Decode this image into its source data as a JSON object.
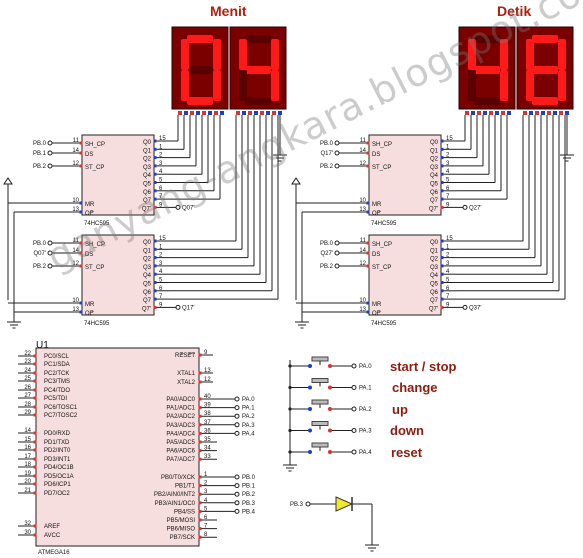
{
  "titles": {
    "minutes": "Menit",
    "seconds": "Detik"
  },
  "displays": {
    "minutes": [
      "0",
      "4"
    ],
    "seconds": [
      "4",
      "8"
    ]
  },
  "colors": {
    "segment_on": "#ff1a1a",
    "display_bg": "#7a0000",
    "chip_fill": "#f7dede",
    "pin_red": "#d83232",
    "pin_blue": "#1c3fc4",
    "wire": "#202020",
    "label_red": "#8c1c10"
  },
  "shift_register": {
    "part": "74HC595",
    "left_pins": [
      {
        "name": "SH_CP",
        "num": "11"
      },
      {
        "name": "DS",
        "num": "14"
      },
      {
        "name": "ST_CP",
        "num": "12"
      },
      {
        "name": "MR",
        "num": "10"
      },
      {
        "name": "OE",
        "num": "13"
      }
    ],
    "right_pins": [
      {
        "name": "Q0",
        "num": "15"
      },
      {
        "name": "Q1",
        "num": "1"
      },
      {
        "name": "Q2",
        "num": "2"
      },
      {
        "name": "Q3",
        "num": "3"
      },
      {
        "name": "Q4",
        "num": "4"
      },
      {
        "name": "Q5",
        "num": "5"
      },
      {
        "name": "Q6",
        "num": "6"
      },
      {
        "name": "Q7",
        "num": "7"
      },
      {
        "name": "Q7'",
        "num": "9"
      }
    ]
  },
  "shift_registers": [
    {
      "nets": [
        "PB.0",
        "PB.1",
        "PB.2"
      ],
      "out": "Q07'"
    },
    {
      "nets": [
        "PB.0",
        "Q07'",
        "PB.2"
      ],
      "out": "Q17'"
    },
    {
      "nets": [
        "PB.0",
        "Q17'",
        "PB.2"
      ],
      "out": "Q27'"
    },
    {
      "nets": [
        "PB.0",
        "Q27'",
        "PB.2"
      ],
      "out": "Q37'"
    }
  ],
  "mcu": {
    "ref": "U1",
    "part": "ATMEGA16",
    "left_pins": [
      {
        "num": "22",
        "name": "PC0/SCL"
      },
      {
        "num": "23",
        "name": "PC1/SDA"
      },
      {
        "num": "24",
        "name": "PC2/TCK"
      },
      {
        "num": "25",
        "name": "PC3/TMS"
      },
      {
        "num": "26",
        "name": "PC4/TDO"
      },
      {
        "num": "27",
        "name": "PC5/TDI"
      },
      {
        "num": "28",
        "name": "PC6/TOSC1"
      },
      {
        "num": "29",
        "name": "PC7/TOSC2"
      },
      {
        "num": "14",
        "name": "PD0/RXD"
      },
      {
        "num": "15",
        "name": "PD1/TXD"
      },
      {
        "num": "16",
        "name": "PD2/INT0"
      },
      {
        "num": "17",
        "name": "PD3/INT1"
      },
      {
        "num": "18",
        "name": "PD4/OC1B"
      },
      {
        "num": "19",
        "name": "PD5/OC1A"
      },
      {
        "num": "20",
        "name": "PD6/ICP1"
      },
      {
        "num": "21",
        "name": "PD7/OC2"
      },
      {
        "num": "32",
        "name": "AREF"
      },
      {
        "num": "30",
        "name": "AVCC"
      }
    ],
    "right_top": [
      {
        "name": "RESET",
        "num": "9"
      },
      {
        "name": "XTAL1",
        "num": "13"
      },
      {
        "name": "XTAL2",
        "num": "12"
      }
    ],
    "port_a": [
      {
        "name": "PA0/ADC0",
        "num": "40",
        "net": "PA.0"
      },
      {
        "name": "PA1/ADC1",
        "num": "39",
        "net": "PA.1"
      },
      {
        "name": "PA2/ADC2",
        "num": "38",
        "net": "PA.2"
      },
      {
        "name": "PA3/ADC3",
        "num": "37",
        "net": "PA.3"
      },
      {
        "name": "PA4/ADC4",
        "num": "36",
        "net": "PA.4"
      },
      {
        "name": "PA5/ADC5",
        "num": "35",
        "net": ""
      },
      {
        "name": "PA6/ADC6",
        "num": "34",
        "net": ""
      },
      {
        "name": "PA7/ADC7",
        "num": "33",
        "net": ""
      }
    ],
    "port_b": [
      {
        "name": "PB0/T0/XCK",
        "num": "1",
        "net": "PB.0"
      },
      {
        "name": "PB1/T1",
        "num": "2",
        "net": "PB.1"
      },
      {
        "name": "PB2/AIN0/INT2",
        "num": "3",
        "net": "PB.2"
      },
      {
        "name": "PB3/AIN1/OC0",
        "num": "4",
        "net": "PB.3"
      },
      {
        "name": "PB4/SS",
        "num": "5",
        "net": "PB.4"
      },
      {
        "name": "PB5/MOSI",
        "num": "6",
        "net": ""
      },
      {
        "name": "PB6/MISO",
        "num": "7",
        "net": ""
      },
      {
        "name": "PB7/SCK",
        "num": "8",
        "net": ""
      }
    ]
  },
  "buttons": [
    {
      "net": "PA.0",
      "label": "start / stop"
    },
    {
      "net": "PA.1",
      "label": "change"
    },
    {
      "net": "PA.2",
      "label": "up"
    },
    {
      "net": "PA.3",
      "label": "down"
    },
    {
      "net": "PA.4",
      "label": "reset"
    }
  ],
  "led": {
    "net": "PB.3"
  },
  "watermark": "ganyang-angkara.blogspot.com"
}
